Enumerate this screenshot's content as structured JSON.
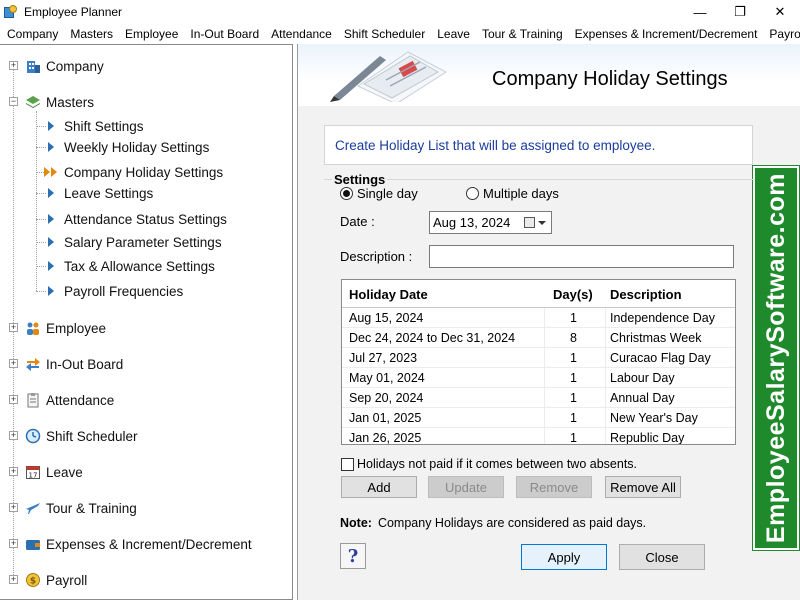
{
  "window": {
    "title": "Employee Planner",
    "minimize": "—",
    "maximize": "❐",
    "close": "✕"
  },
  "menu": [
    "Company",
    "Masters",
    "Employee",
    "In-Out Board",
    "Attendance",
    "Shift Scheduler",
    "Leave",
    "Tour & Training",
    "Expenses & Increment/Decrement",
    "Payroll"
  ],
  "tree": {
    "company": "Company",
    "masters": "Masters",
    "masters_children": [
      "Shift Settings",
      "Weekly Holiday Settings",
      "Company Holiday Settings",
      "Leave Settings",
      "Attendance Status Settings",
      "Salary Parameter Settings",
      "Tax & Allowance Settings",
      "Payroll Frequencies"
    ],
    "employee": "Employee",
    "in_out_board": "In-Out Board",
    "attendance": "Attendance",
    "shift_scheduler": "Shift Scheduler",
    "leave": "Leave",
    "tour_training": "Tour & Training",
    "expenses": "Expenses & Increment/Decrement",
    "payroll": "Payroll"
  },
  "page": {
    "title": "Company Holiday Settings",
    "info": "Create Holiday List that will be assigned to employee.",
    "brand": "EmployeeSalarySoftware.com",
    "settings_legend": "Settings",
    "single_day": "Single day",
    "multiple_days": "Multiple days",
    "date_label": "Date :",
    "date_value": "Aug 13, 2024",
    "description_label": "Description :",
    "description_value": "",
    "grid": {
      "headers": [
        "Holiday Date",
        "Day(s)",
        "Description"
      ],
      "rows": [
        [
          "Aug 15, 2024",
          "1",
          "Independence Day"
        ],
        [
          "Dec 24, 2024 to Dec 31, 2024",
          "8",
          "Christmas Week"
        ],
        [
          "Jul 27, 2023",
          "1",
          "Curacao Flag Day"
        ],
        [
          "May 01, 2024",
          "1",
          "Labour Day"
        ],
        [
          "Sep 20, 2024",
          "1",
          "Annual Day"
        ],
        [
          "Jan 01, 2025",
          "1",
          "New Year's Day"
        ],
        [
          "Jan 26, 2025",
          "1",
          "Republic Day"
        ]
      ]
    },
    "not_paid_label": "Holidays not paid if it comes between two absents.",
    "buttons": {
      "add": "Add",
      "update": "Update",
      "remove": "Remove",
      "remove_all": "Remove All",
      "apply": "Apply",
      "close": "Close",
      "help": "?"
    },
    "note_label": "Note:",
    "note_text": "Company Holidays are considered as paid days."
  }
}
